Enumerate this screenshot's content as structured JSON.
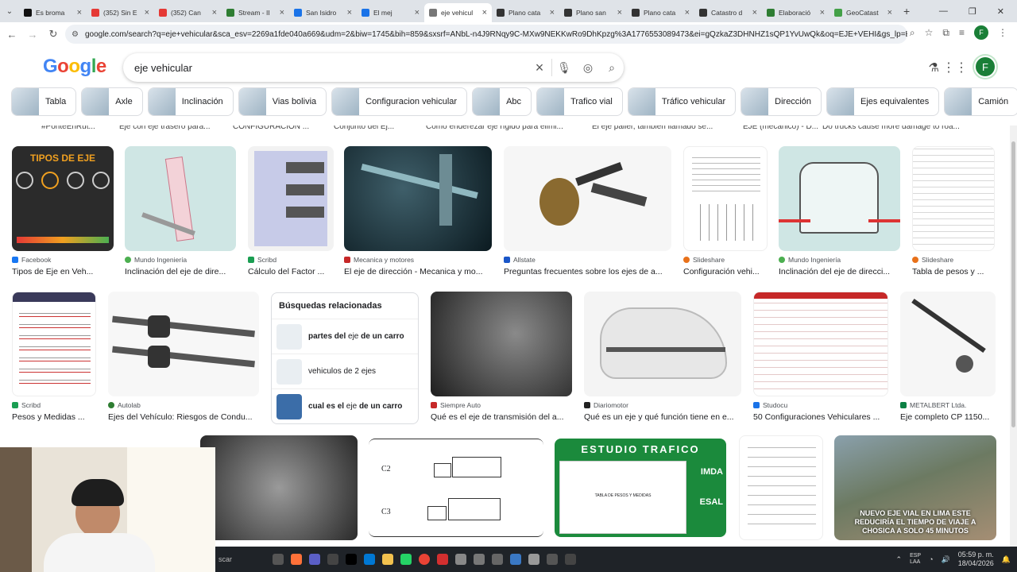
{
  "browser": {
    "tabs": [
      {
        "title": "Es broma",
        "color": "#111111"
      },
      {
        "title": "(352) Sin E",
        "color": "#e53935"
      },
      {
        "title": "(352) Can",
        "color": "#e53935"
      },
      {
        "title": "Stream - II",
        "color": "#2e7d32"
      },
      {
        "title": "San Isidro",
        "color": "#1a73e8"
      },
      {
        "title": "El mej",
        "color": "#1a73e8"
      },
      {
        "title": "eje vehicul",
        "color": "#777777",
        "active": true
      },
      {
        "title": "Plano cata",
        "color": "#333333"
      },
      {
        "title": "Plano san",
        "color": "#333333"
      },
      {
        "title": "Plano cata",
        "color": "#333333"
      },
      {
        "title": "Catastro d",
        "color": "#333333"
      },
      {
        "title": "Elaboració",
        "color": "#2e7d32"
      },
      {
        "title": "GeoCatast",
        "color": "#43a047"
      }
    ],
    "url": "google.com/search?q=eje+vehicular&sca_esv=2269a1fde040a669&udm=2&biw=1745&bih=859&sxsrf=ANbL-n4J9RNqy9C-MXw9NEKKwRo9DhKpzg%3A1776553089473&ei=gQzkaZ3DHNHZ1sQP1YvUwQk&oq=EJE+VEHI&gs_lp=Egtnd3Mtd...",
    "profile_initial": "F"
  },
  "google": {
    "logo": "Google",
    "query": "eje vehicular",
    "avatar_initial": "F",
    "chips": [
      "Tabla",
      "Axle",
      "Inclinación",
      "Vias bolivia",
      "Configuracion vehicular",
      "Abc",
      "Trafico vial",
      "Tráfico vehicular",
      "Dirección",
      "Ejes equivalentes",
      "Camión"
    ]
  },
  "cut_row": [
    "#PonteEnRut...",
    "Eje con eje trasero para...",
    "CONFIGURACIÓN ...",
    "Conjunto del Ej...",
    "Cómo enderezar eje rígido para elimi...",
    "El eje palier, también llamado se...",
    "EJE (mecánico) - D...",
    "Do trucks cause more damage to roa..."
  ],
  "row1": [
    {
      "source": "Facebook",
      "title": "Tipos de Eje en Veh...",
      "img_title": "TIPOS DE EJE"
    },
    {
      "source": "Mundo Ingeniería",
      "title": "Inclinación del eje de dire..."
    },
    {
      "source": "Scribd",
      "title": "Cálculo del Factor ..."
    },
    {
      "source": "Mecanica y motores",
      "title": "El eje de dirección - Mecanica y mo..."
    },
    {
      "source": "Allstate",
      "title": "Preguntas frecuentes sobre los ejes de a..."
    },
    {
      "source": "Slideshare",
      "title": "Configuración vehi..."
    },
    {
      "source": "Mundo Ingeniería",
      "title": "Inclinación del eje de direcci..."
    },
    {
      "source": "Slideshare",
      "title": "Tabla de pesos y ..."
    }
  ],
  "row2": [
    {
      "source": "Scribd",
      "title": "Pesos y Medidas ..."
    },
    {
      "source": "Autolab",
      "title": "Ejes del Vehículo: Riesgos de Condu..."
    },
    {
      "source": "Siempre Auto",
      "title": "Qué es el eje de transmisión del a..."
    },
    {
      "source": "Diariomotor",
      "title": "Qué es un eje y qué función tiene en e..."
    },
    {
      "source": "Studocu",
      "title": "50 Configuraciones Vehiculares ..."
    },
    {
      "source": "METALBERT Ltda.",
      "title": "Eje completo CP 1150..."
    }
  ],
  "related": {
    "heading": "Búsquedas relacionadas",
    "items": [
      {
        "bold1": "partes del",
        "normal": " eje ",
        "bold2": "de un carro"
      },
      {
        "bold1": "",
        "normal": "vehiculos de 2 ejes",
        "bold2": ""
      },
      {
        "bold1": "cual es el",
        "normal": " eje ",
        "bold2": "de un carro"
      }
    ]
  },
  "row3": {
    "diagram_labels": [
      "C2",
      "C3"
    ],
    "traffic_title": "ESTUDIO TRAFICO",
    "traffic_side1": "IMDA",
    "traffic_side2": "ESAL",
    "traffic_sub": "TABLA DE PESOS Y MEDIDAS",
    "city_caption": "NUEVO EJE VIAL EN LIMA ESTE REDUCIRÍA EL TIEMPO DE VIAJE A CHOSICA A SOLO 45 MINUTOS"
  },
  "taskbar": {
    "search": "scar",
    "lang": "ESP\nLAA",
    "time": "05:59 p. m.",
    "date": "18/04/2026"
  }
}
